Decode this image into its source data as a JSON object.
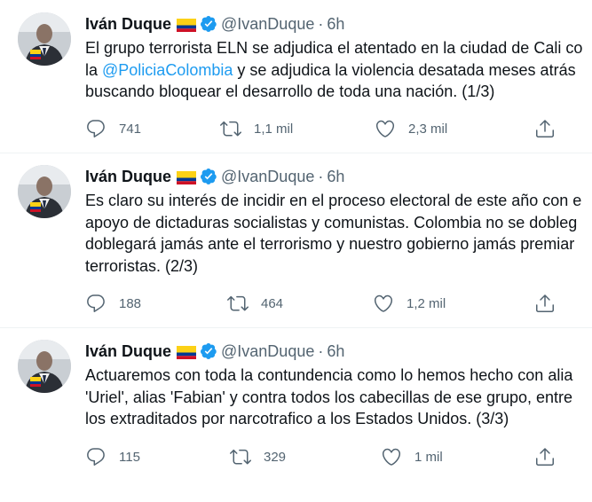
{
  "tweets": [
    {
      "author": {
        "name": "Iván Duque",
        "handle": "@IvanDuque",
        "time": "6h",
        "flag_colors": [
          "#fcd116",
          "#003893",
          "#ce1126"
        ],
        "verified_color": "#1d9bf0"
      },
      "lines": [
        {
          "pre": "El grupo terrorista ELN se adjudica el atentado en la ciudad de Cali co",
          "mention": "",
          "post": ""
        },
        {
          "pre": "la ",
          "mention": "@PoliciaColombia",
          "post": " y se adjudica la violencia desatada meses atrás"
        },
        {
          "pre": "buscando bloquear el desarrollo de toda una nación. (1/3)",
          "mention": "",
          "post": ""
        }
      ],
      "actions": {
        "replies": "741",
        "retweets": "1,1 mil",
        "likes": "2,3 mil"
      }
    },
    {
      "author": {
        "name": "Iván Duque",
        "handle": "@IvanDuque",
        "time": "6h"
      },
      "lines": [
        {
          "pre": "Es claro su interés de incidir en el proceso electoral de este año con e",
          "mention": "",
          "post": ""
        },
        {
          "pre": "apoyo de dictaduras socialistas y comunistas. Colombia no se dobleg",
          "mention": "",
          "post": ""
        },
        {
          "pre": "doblegará jamás ante el terrorismo y nuestro gobierno jamás premiar",
          "mention": "",
          "post": ""
        },
        {
          "pre": "terroristas. (2/3)",
          "mention": "",
          "post": ""
        }
      ],
      "actions": {
        "replies": "188",
        "retweets": "464",
        "likes": "1,2 mil"
      }
    },
    {
      "author": {
        "name": "Iván Duque",
        "handle": "@IvanDuque",
        "time": "6h"
      },
      "lines": [
        {
          "pre": "Actuaremos con toda la contundencia como lo hemos hecho con alia",
          "mention": "",
          "post": ""
        },
        {
          "pre": "'Uriel', alias 'Fabian' y contra todos los cabecillas de ese grupo, entre",
          "mention": "",
          "post": ""
        },
        {
          "pre": "los extraditados por narcotrafico a los Estados Unidos. (3/3)",
          "mention": "",
          "post": ""
        }
      ],
      "actions": {
        "replies": "115",
        "retweets": "329",
        "likes": "1 mil"
      }
    }
  ],
  "colors": {
    "text": "#0f1419",
    "secondary": "#536471",
    "link": "#1d9bf0",
    "divider": "#eff3f4"
  },
  "icons": {
    "reply": "reply-icon",
    "retweet": "retweet-icon",
    "like": "heart-icon",
    "share": "share-icon"
  }
}
